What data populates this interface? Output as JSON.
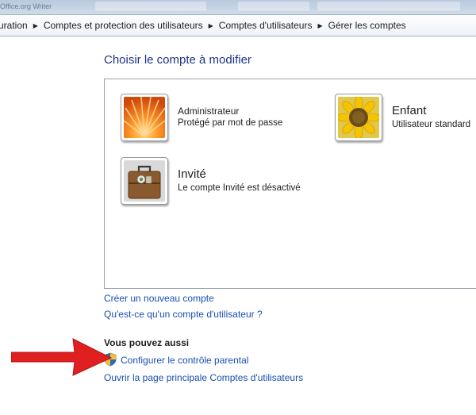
{
  "window": {
    "title_fragment": "Office.org Writer"
  },
  "breadcrumb": {
    "items": [
      "uration",
      "Comptes et protection des utilisateurs",
      "Comptes d'utilisateurs",
      "Gérer les comptes"
    ]
  },
  "main": {
    "heading": "Choisir le compte à modifier",
    "accounts": [
      {
        "name": "Administrateur",
        "subtitle": "Protégé par mot de passe",
        "picture": "orange-flower"
      },
      {
        "name": "Enfant",
        "subtitle": "Utilisateur standard",
        "picture": "sunflower"
      },
      {
        "name": "Invité",
        "subtitle": "Le compte Invité est désactivé",
        "picture": "suitcase"
      }
    ],
    "links": {
      "create_account": "Créer un nouveau compte",
      "what_is_account": "Qu'est-ce qu'un compte d'utilisateur ?"
    },
    "also_section": {
      "title": "Vous pouvez aussi",
      "parental_controls": "Configurer le contrôle parental",
      "main_page": "Ouvrir la page principale Comptes d'utilisateurs"
    }
  },
  "annotation": {
    "arrow_color": "#e02020"
  },
  "colors": {
    "link": "#1a4fb0",
    "heading": "#1e3287",
    "breadcrumb_border": "#9fb1c8"
  }
}
